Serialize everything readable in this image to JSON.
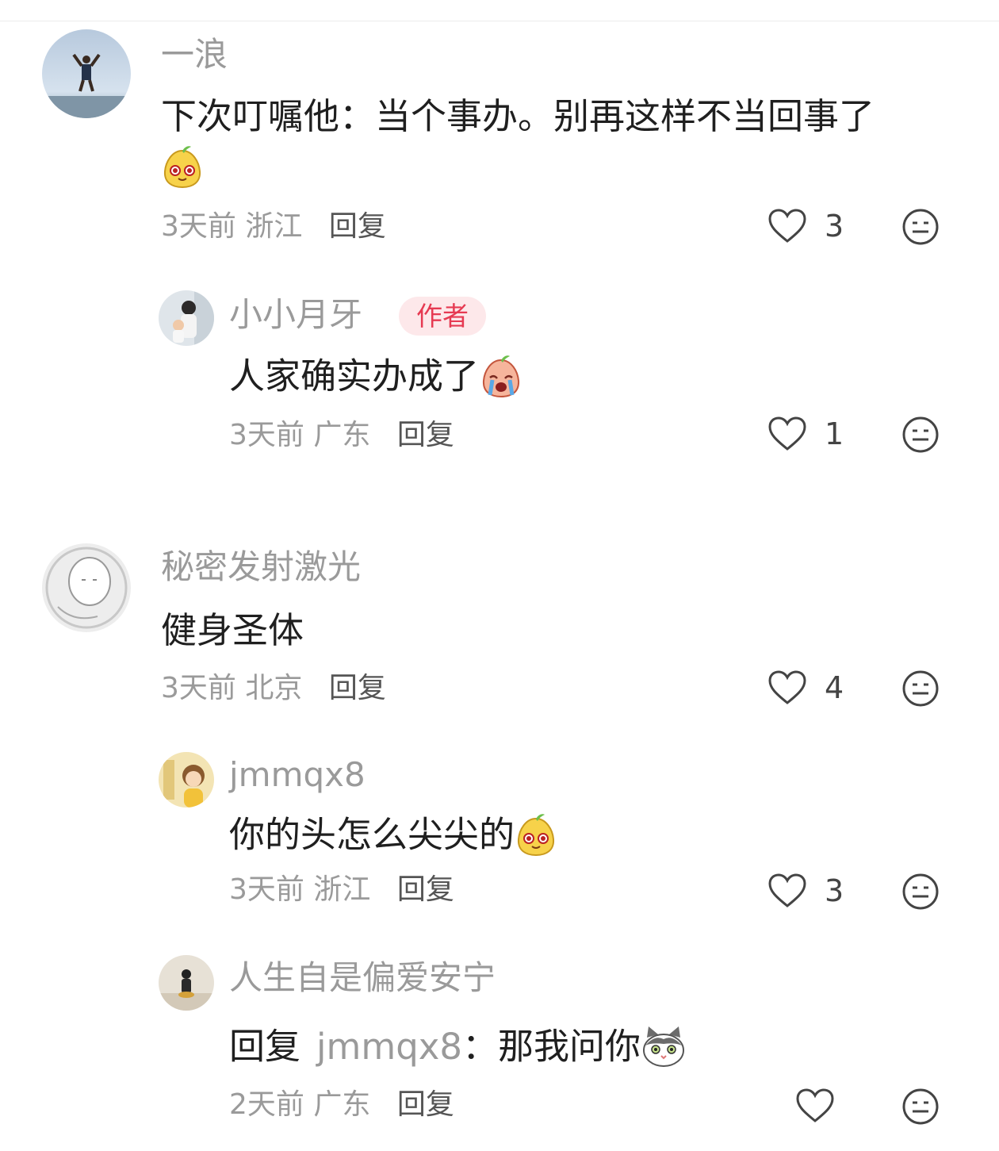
{
  "comments": [
    {
      "user": "一浪",
      "text_line1": "下次叮嘱他：当个事办。别再这样不当回事了",
      "emoji": "pear-face-emoji",
      "time": "3天前",
      "location": "浙江",
      "reply_label": "回复",
      "likes": "3"
    },
    {
      "user": "小小月牙",
      "badge": "作者",
      "text": "人家确实办成了",
      "emoji": "pear-crying-emoji",
      "time": "3天前",
      "location": "广东",
      "reply_label": "回复",
      "likes": "1"
    },
    {
      "user": "秘密发射激光",
      "text": "健身圣体",
      "time": "3天前",
      "location": "北京",
      "reply_label": "回复",
      "likes": "4"
    },
    {
      "user": "jmmqx8",
      "text": "你的头怎么尖尖的",
      "emoji": "pear-face-emoji",
      "time": "3天前",
      "location": "浙江",
      "reply_label": "回复",
      "likes": "3"
    },
    {
      "user": "人生自是偏爱安宁",
      "reply_prefix": "回复",
      "mention": "jmmqx8",
      "text": "：那我问你",
      "emoji": "cat-face-emoji",
      "time": "2天前",
      "location": "广东",
      "reply_label": "回复",
      "likes": ""
    }
  ],
  "colors": {
    "secondary_text": "#9a9a9a",
    "primary_text": "#1f1f1f",
    "badge_bg": "#fde8ea",
    "badge_text": "#e63a52"
  }
}
